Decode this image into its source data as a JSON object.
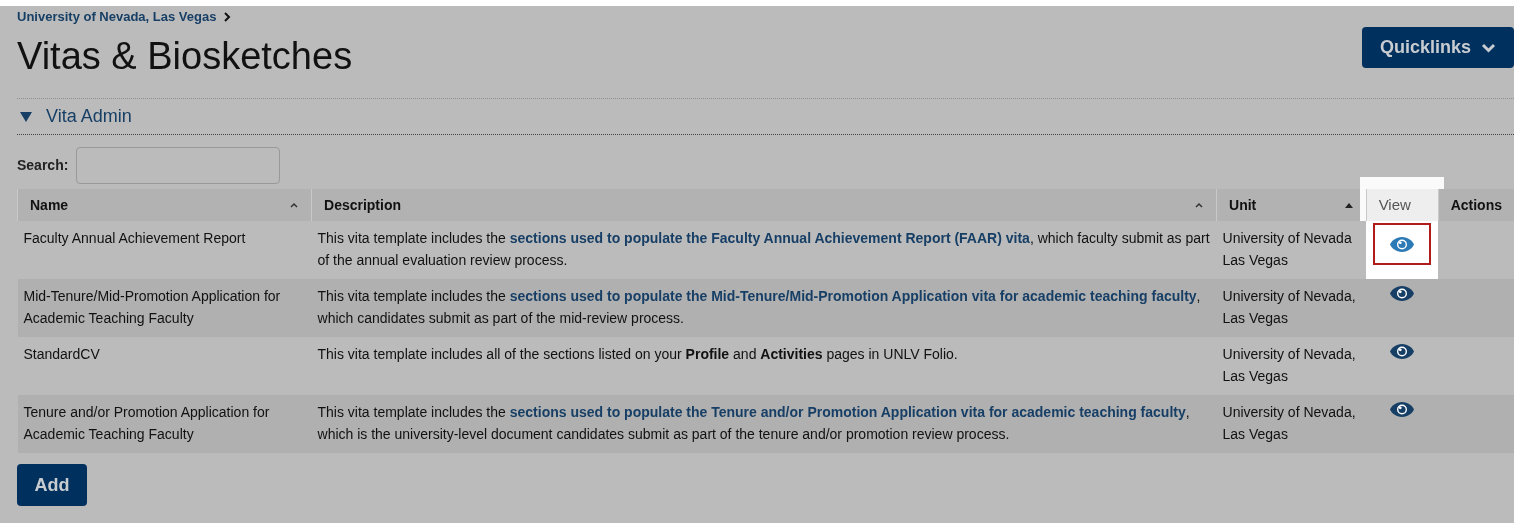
{
  "breadcrumb": {
    "label": "University of Nevada, Las Vegas"
  },
  "title": "Vitas & Biosketches",
  "quicklinks_button": {
    "label": "Quicklinks"
  },
  "section": {
    "label": "Vita Admin",
    "expanded": true
  },
  "search": {
    "label": "Search:"
  },
  "table": {
    "columns": [
      {
        "label": "Name",
        "sorted": false,
        "highlighted": false
      },
      {
        "label": "Description",
        "sorted": false,
        "highlighted": false
      },
      {
        "label": "Unit",
        "sorted": true,
        "highlighted": false
      },
      {
        "label": "View",
        "highlighted": true
      },
      {
        "label": "Actions",
        "highlighted": false
      }
    ],
    "rows": [
      {
        "name": "Faculty Annual Achievement Report",
        "description": [
          {
            "kind": "text",
            "text": "This vita template includes the "
          },
          {
            "kind": "link",
            "text": "sections used to populate the Faculty Annual Achievement Report (FAAR) vita"
          },
          {
            "kind": "text",
            "text": ", which faculty submit as part of the annual evaluation review process."
          }
        ],
        "unit": "University of Nevada Las Vegas",
        "highlighted": true
      },
      {
        "name": "Mid-Tenure/Mid-Promotion Application for Academic Teaching Faculty",
        "description": [
          {
            "kind": "text",
            "text": "This vita template includes the "
          },
          {
            "kind": "link",
            "text": "sections used to populate the Mid-Tenure/Mid-Promotion Application vita for academic teaching faculty"
          },
          {
            "kind": "text",
            "text": ", which candidates submit as part of the mid-review process."
          }
        ],
        "unit": "University of Nevada, Las Vegas",
        "highlighted": false
      },
      {
        "name": "StandardCV",
        "description": [
          {
            "kind": "text",
            "text": "This vita template includes all of the sections listed on your **Profile** and **Activities** pages in UNLV Folio."
          }
        ],
        "unit": "University of Nevada, Las Vegas",
        "highlighted": false
      },
      {
        "name": "Tenure and/or Promotion Application for Academic Teaching Faculty",
        "description": [
          {
            "kind": "text",
            "text": "This vita template includes the "
          },
          {
            "kind": "link",
            "text": "sections used to populate the Tenure and/or Promotion Application vita for academic teaching faculty"
          },
          {
            "kind": "text",
            "text": ", which is the university-level document candidates submit as part of the tenure and/or promotion review process."
          }
        ],
        "unit": "University of Nevada, Las Vegas",
        "highlighted": false
      }
    ]
  },
  "add_button": {
    "label": "Add"
  }
}
